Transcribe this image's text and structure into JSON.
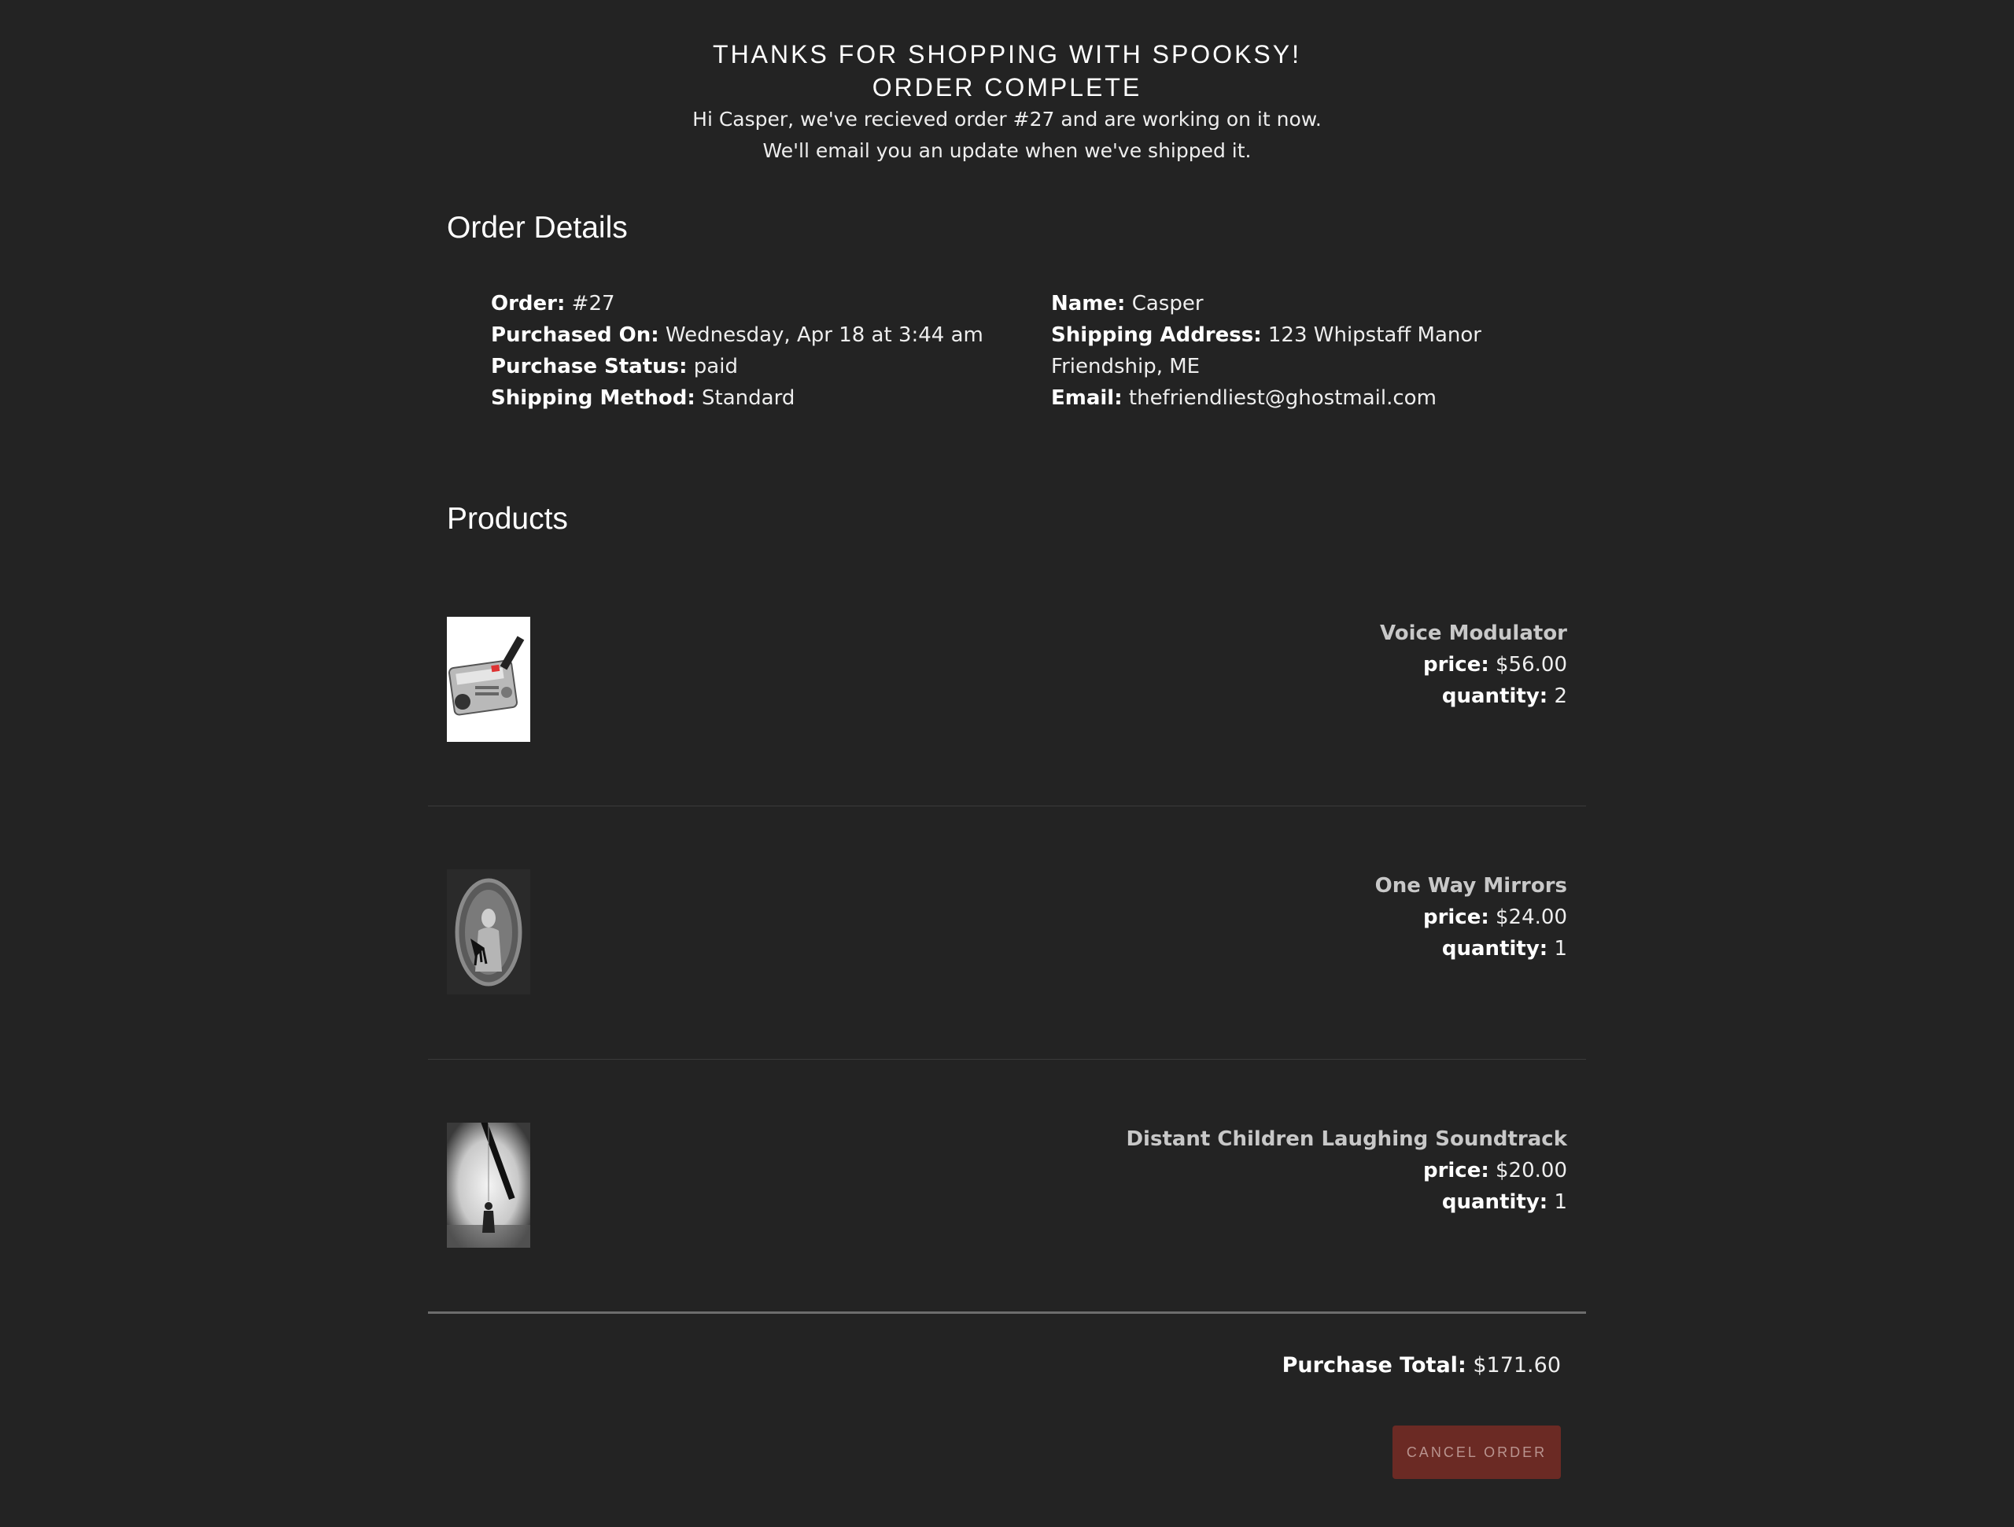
{
  "header": {
    "line1": "THANKS FOR SHOPPING WITH SPOOKSY!",
    "line2": "ORDER COMPLETE",
    "message1": "Hi Casper, we've recieved order #27 and are working on it now.",
    "message2": "We'll email you an update when we've shipped it."
  },
  "order_details": {
    "title": "Order Details",
    "order_label": "Order:",
    "order_value": "#27",
    "purchased_label": "Purchased On:",
    "purchased_value": "Wednesday, Apr 18 at 3:44 am",
    "status_label": "Purchase Status:",
    "status_value": "paid",
    "shipping_method_label": "Shipping Method:",
    "shipping_method_value": "Standard",
    "name_label": "Name:",
    "name_value": "Casper",
    "address_label": "Shipping Address:",
    "address_value": "123 Whipstaff Manor Friendship, ME",
    "email_label": "Email:",
    "email_value": "thefriendliest@ghostmail.com"
  },
  "products": {
    "title": "Products",
    "price_label": "price:",
    "quantity_label": "quantity:",
    "items": [
      {
        "name": "Voice Modulator",
        "price": "$56.00",
        "quantity": "2",
        "image_icon": "voice-modulator-image"
      },
      {
        "name": "One Way Mirrors",
        "price": "$24.00",
        "quantity": "1",
        "image_icon": "mirror-image"
      },
      {
        "name": "Distant Children Laughing Soundtrack",
        "price": "$20.00",
        "quantity": "1",
        "image_icon": "foggy-figure-image"
      }
    ]
  },
  "summary": {
    "total_label": "Purchase Total:",
    "total_value": "$171.60",
    "cancel_label": "CANCEL ORDER"
  },
  "colors": {
    "background": "#232323",
    "cancel_button": "#6b2a24",
    "cancel_text": "#b9948f"
  }
}
